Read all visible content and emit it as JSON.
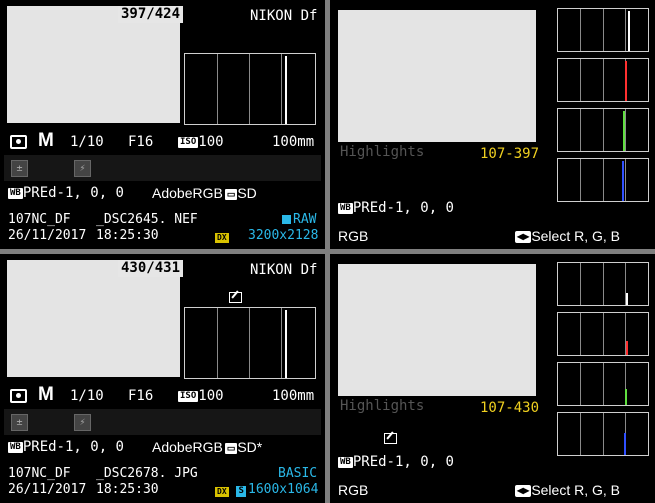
{
  "top_left": {
    "counter": "397/424",
    "camera": "NIKON Df",
    "metering_icon": "matrix-metering-icon",
    "mode": "M",
    "shutter": "1/10",
    "aperture": "F16",
    "iso_label": "ISO",
    "iso_value": "100",
    "focal": "100mm",
    "exposure_comp_icon": "exposure-compensation-icon",
    "flash_comp_icon": "flash-compensation-icon",
    "wb_label": "WB",
    "wb_value": "PREd-1,  0,  0",
    "color_space": "AdobeRGB",
    "picture_control": "SD",
    "folder": "107NC_DF",
    "filename": "_DSC2645. NEF",
    "quality": "RAW",
    "date": "26/11/2017",
    "time": "18:25:30",
    "area_badge": "DX",
    "size": "3200x2128"
  },
  "top_right": {
    "highlights_label": "Highlights",
    "file_id": "107-397",
    "wb_label": "WB",
    "wb_value": "PREd-1,  0,  0",
    "channel_label": "RGB",
    "select_label": "Select R, G, B"
  },
  "bottom_left": {
    "counter": "430/431",
    "camera": "NIKON Df",
    "retouch_icon": "retouch-icon",
    "mode": "M",
    "shutter": "1/10",
    "aperture": "F16",
    "iso_label": "ISO",
    "iso_value": "100",
    "focal": "100mm",
    "wb_label": "WB",
    "wb_value": "PREd-1,  0,  0",
    "color_space": "AdobeRGB",
    "picture_control": "SD*",
    "folder": "107NC_DF",
    "filename": "_DSC2678. JPG",
    "quality": "BASIC",
    "date": "26/11/2017",
    "time": "18:25:30",
    "area_badge": "DX",
    "size_badge": "S",
    "size": "1600x1064"
  },
  "bottom_right": {
    "highlights_label": "Highlights",
    "file_id": "107-430",
    "wb_label": "WB",
    "wb_value": "PREd-1,  0,  0",
    "channel_label": "RGB",
    "select_label": "Select R, G, B"
  },
  "colors": {
    "red": "#ff3030",
    "green": "#60e040",
    "blue": "#3050ff",
    "white": "#ffffff",
    "cyan": "#2ab8e8",
    "yellow": "#f0d020"
  }
}
